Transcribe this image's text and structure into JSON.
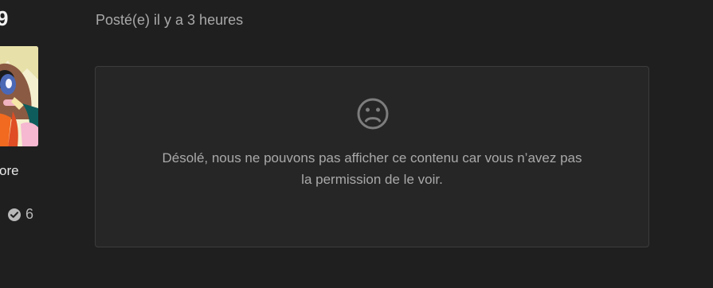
{
  "author": {
    "name_fragment": "9",
    "rank_fragment": "ore",
    "reputation": "6"
  },
  "post": {
    "meta": "Posté(e) il y a 3 heures"
  },
  "notice": {
    "icon": "sad-face-icon",
    "line1": "Désolé, nous ne pouvons pas afficher ce contenu car vous n’avez pas",
    "line2": "la permission de le voir."
  },
  "colors": {
    "background": "#1f1f1f",
    "box": "#262626",
    "border": "#3c3c3c",
    "text_muted": "#a9a9a9"
  }
}
